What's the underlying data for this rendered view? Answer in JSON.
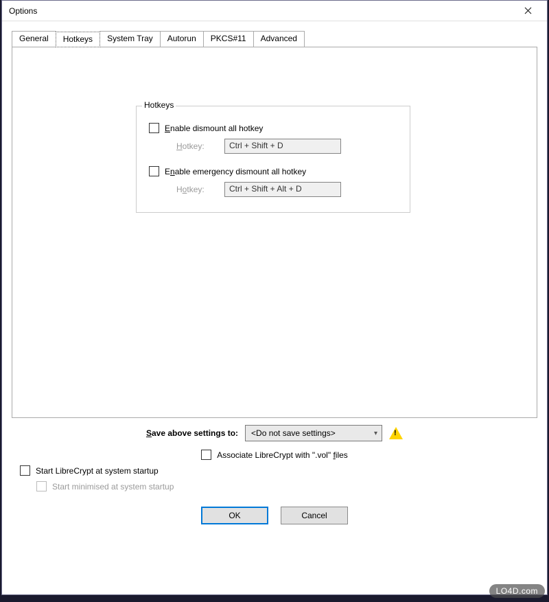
{
  "window": {
    "title": "Options"
  },
  "tabs": [
    {
      "label": "General"
    },
    {
      "label": "Hotkeys"
    },
    {
      "label": "System Tray"
    },
    {
      "label": "Autorun"
    },
    {
      "label": "PKCS#11"
    },
    {
      "label": "Advanced"
    }
  ],
  "active_tab_index": 1,
  "hotkeys_group": {
    "legend": "Hotkeys",
    "enable_dismount": {
      "label": "Enable dismount all hotkey",
      "checked": false,
      "hotkey_label": "Hotkey:",
      "hotkey_value": "Ctrl + Shift + D"
    },
    "enable_emergency": {
      "label": "Enable emergency dismount all hotkey",
      "checked": false,
      "hotkey_label": "Hotkey:",
      "hotkey_value": "Ctrl + Shift + Alt + D"
    }
  },
  "save_settings": {
    "label": "Save above settings to:",
    "value": "<Do not save settings>"
  },
  "associate": {
    "label": "Associate LibreCrypt with \".vol\" files",
    "checked": false
  },
  "startup": {
    "label": "Start LibreCrypt at system startup",
    "checked": false
  },
  "start_minimised": {
    "label": "Start minimised at system startup",
    "checked": false,
    "disabled": true
  },
  "buttons": {
    "ok": "OK",
    "cancel": "Cancel"
  },
  "watermark": "LO4D.com"
}
